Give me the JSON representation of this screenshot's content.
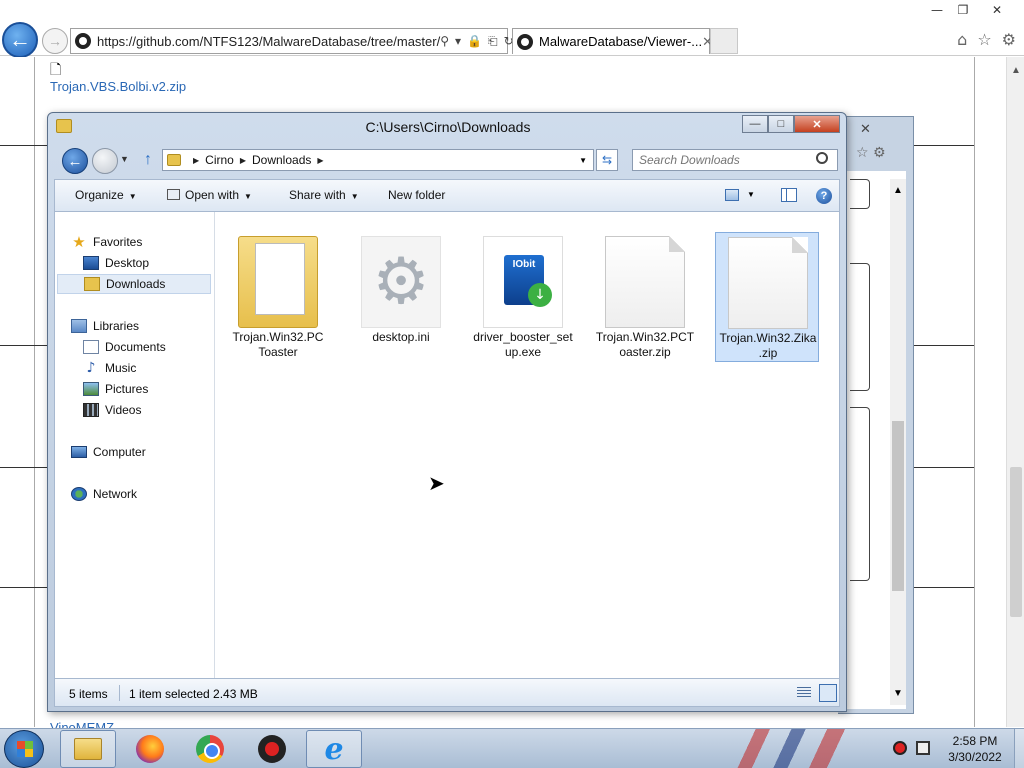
{
  "browser": {
    "url": "https://github.com/NTFS123/MalwareDatabase/tree/master/",
    "tab_title": "MalwareDatabase/Viewer-...",
    "window_controls": {
      "minimize": "—",
      "restore": "❐",
      "close": "✕"
    },
    "nav_icons": {
      "back": "back-arrow-icon",
      "forward": "forward-arrow-icon"
    },
    "addr_tools": {
      "search": "⚲",
      "dropdown": "▾",
      "lock": "🔒",
      "compat": "⎗",
      "refresh": "↻"
    },
    "tab_close": "✕",
    "right_icons": {
      "home": "⌂",
      "favorites": "☆",
      "settings": "⚙"
    }
  },
  "webpage": {
    "file_icon": "🗋",
    "link_above": "Trojan.VBS.Bolbi.v2.zip",
    "link_below": "VinoMEMZ"
  },
  "background_window": {
    "close": "✕",
    "icons": "☆ ⚙",
    "scroll_up": "▲",
    "scroll_down": "▼"
  },
  "explorer": {
    "title": "C:\\Users\\Cirno\\Downloads",
    "caption_buttons": {
      "minimize": "—",
      "maximize": "□",
      "close": "✕"
    },
    "breadcrumbs": [
      "Cirno",
      "Downloads"
    ],
    "search_placeholder": "Search Downloads",
    "toolbar": {
      "organize": "Organize",
      "open_with": "Open with",
      "share_with": "Share with",
      "new_folder": "New folder",
      "help": "?"
    },
    "nav_pane": {
      "favorites": "Favorites",
      "desktop": "Desktop",
      "downloads": "Downloads",
      "libraries": "Libraries",
      "documents": "Documents",
      "music": "Music",
      "pictures": "Pictures",
      "videos": "Videos",
      "computer": "Computer",
      "network": "Network"
    },
    "files": [
      {
        "name": "Trojan.Win32.PC Toaster",
        "icon": "folder-icon",
        "selected": false
      },
      {
        "name": "desktop.ini",
        "icon": "gear-settings-icon",
        "selected": false
      },
      {
        "name": "driver_booster_setup.exe",
        "icon": "iobit-installer-icon",
        "selected": false,
        "icon_text": "IObit"
      },
      {
        "name": "Trojan.Win32.PCToaster.zip",
        "icon": "blank-file-icon",
        "selected": false
      },
      {
        "name": "Trojan.Win32.Zika.zip",
        "icon": "blank-file-icon",
        "selected": true
      }
    ],
    "status": {
      "item_count": "5 items",
      "selection": "1 item selected  2.43 MB"
    }
  },
  "taskbar": {
    "apps": [
      {
        "name": "windows-explorer",
        "active": true
      },
      {
        "name": "firefox",
        "active": false
      },
      {
        "name": "chrome",
        "active": false
      },
      {
        "name": "ransomware-app",
        "active": false
      },
      {
        "name": "internet-explorer",
        "active": true
      }
    ],
    "clock": {
      "time": "2:58 PM",
      "date": "3/30/2022"
    },
    "ie_glyph": "e"
  }
}
